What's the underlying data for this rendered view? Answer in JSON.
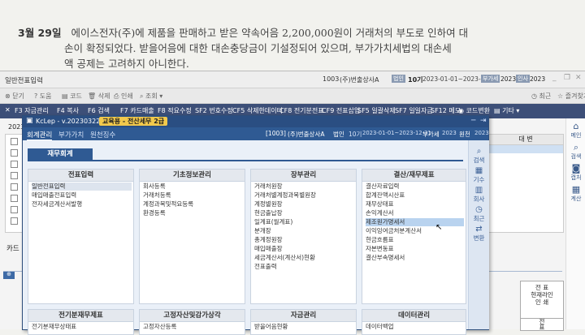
{
  "question": {
    "number": "3월 29일",
    "line1": "에이스전자(주)에 제품을 판매하고 받은 약속어음 2,200,000원이 거래처의 부도로 인하여 대",
    "line2": "손이 확정되었다. 받을어음에 대한 대손충당금이 기설정되어 있으며, 부가가치세법의 대손세",
    "line3": "액 공제는 고려하지 아니한다."
  },
  "outer": {
    "title": "일반전표입력",
    "company_code": "1003",
    "company_name": "(주)번출상사A",
    "period_label": "법인",
    "term": "10기",
    "date_range": "2023-01-01~2023-12-31",
    "vat_label": "부가세",
    "year": "2023",
    "year_label": "인사",
    "year2": "2023",
    "toolbar": [
      "닫기",
      "도움",
      "코드",
      "삭제",
      "인쇄",
      "조회"
    ],
    "menu": [
      "F3 자금관리",
      "F4 복사",
      "F6 검색",
      "F7 카드매출",
      "F8 적요수정",
      "SF2 번호수정",
      "CF5 삭제한데이터",
      "CF8 전기분전표",
      "CF9 전표삽입",
      "SF5 일괄삭제",
      "SF7 일일자금",
      "SF12 메모",
      "코드변환",
      "기타"
    ],
    "right_buttons": [
      "최근",
      "즐겨찾기"
    ],
    "year_partial": "2023",
    "col_partial": "대 변",
    "card_partial": "카드",
    "sidebar": [
      {
        "icon": "home-icon",
        "label": "메인"
      },
      {
        "icon": "search-icon",
        "label": "검색"
      },
      {
        "icon": "camera-icon",
        "label": "캡처"
      },
      {
        "icon": "calculator-icon",
        "label": "계산"
      }
    ],
    "bottom_right_box1": "전 표\n현재라인\n인 쇄",
    "bottom_right_box2": "전\n표"
  },
  "inner": {
    "title": "KcLep - v.20230322",
    "edition": "교육용 - 전산세무 2급",
    "company_code": "[1003]",
    "company_name": "(주)번출상사A",
    "entity": "법인",
    "term": "10기",
    "date_range": "2023-01-01~2023-12-31",
    "vat": "부가세",
    "year": "2023",
    "payroll": "원천",
    "year2": "2023",
    "tabs": [
      "회계관리",
      "부가가치",
      "원천징수"
    ],
    "section": "재무회계",
    "right_bar": [
      {
        "icon": "search-icon",
        "label": "검색"
      },
      {
        "icon": "calendar-icon",
        "label": "기수"
      },
      {
        "icon": "building-icon",
        "label": "회사"
      },
      {
        "icon": "clock-icon",
        "label": "최근"
      },
      {
        "icon": "transfer-icon",
        "label": "변환"
      }
    ],
    "panels": [
      {
        "title": "전표입력",
        "items": [
          "일반전표입력",
          "매입매출전표입력",
          "전자세금계산서발행"
        ]
      },
      {
        "title": "기초정보관리",
        "items": [
          "회사등록",
          "거래처등록",
          "계정과목및적요등록",
          "환경등록"
        ]
      },
      {
        "title": "장부관리",
        "items": [
          "거래처원장",
          "거래처별계정과목별원장",
          "계정별원장",
          "현금출납장",
          "일계표(월계표)",
          "분개장",
          "총계정원장",
          "매입매출장",
          "세금계산서(계산서)현황",
          "전표출력"
        ]
      },
      {
        "title": "결산/재무제표",
        "items": [
          "결산자료입력",
          "합계잔액시산표",
          "재무상태표",
          "손익계산서",
          "제조원가명세서",
          "이익잉여금처분계산서",
          "현금흐름표",
          "자본변동표",
          "결산부속명세서"
        ]
      }
    ],
    "bottom_panels": [
      {
        "title": "전기분재무제표",
        "item": "전기분재무상태표"
      },
      {
        "title": "고정자산및감가상각",
        "item": "고정자산등록"
      },
      {
        "title": "자금관리",
        "item": "받을어음현황"
      },
      {
        "title": "데이터관리",
        "item": "데이터백업"
      }
    ]
  }
}
